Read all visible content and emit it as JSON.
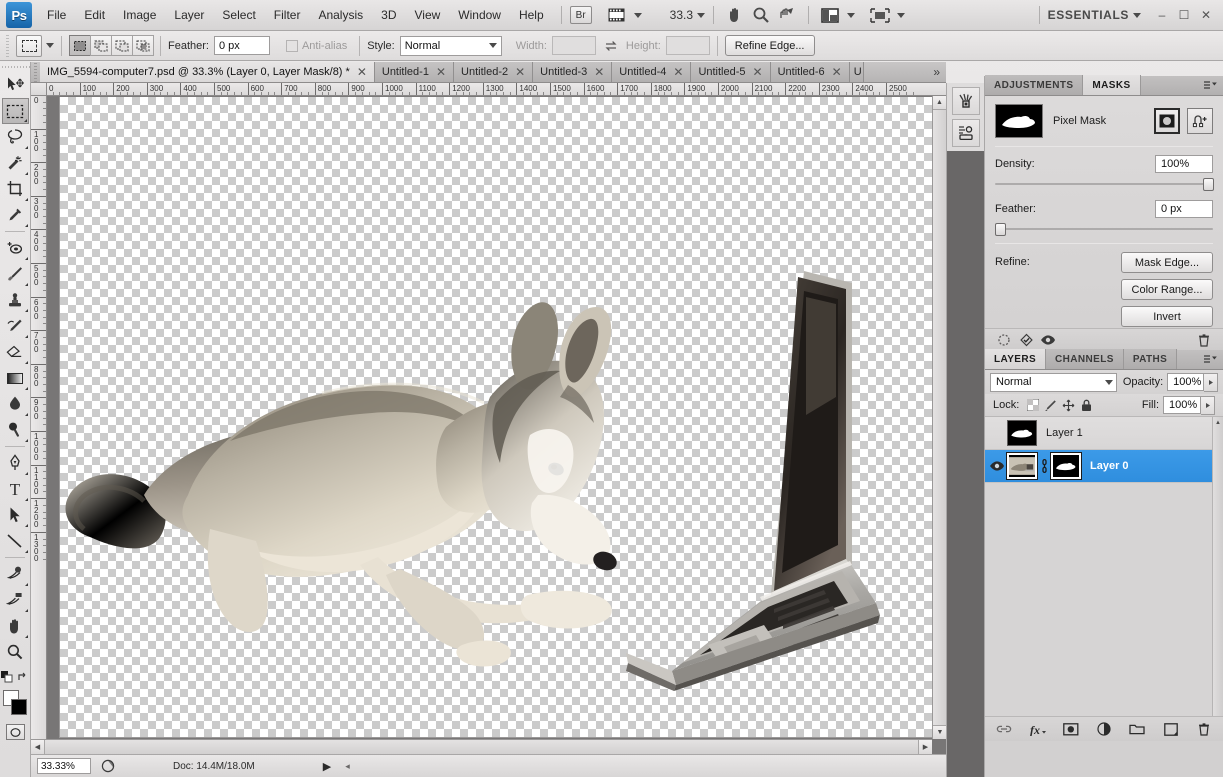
{
  "app": {
    "logo": "Ps",
    "menus": [
      "File",
      "Edit",
      "Image",
      "Layer",
      "Select",
      "Filter",
      "Analysis",
      "3D",
      "View",
      "Window",
      "Help"
    ],
    "bridge_label": "Br",
    "zoom_level": "33.3",
    "workspace": "ESSENTIALS",
    "window_buttons": {
      "minimize": "–",
      "maximize": "☐",
      "close": "✕"
    },
    "icons": {
      "view_extras": "view-extras-icon",
      "hand": "hand-tool-icon",
      "zoom": "zoom-tool-icon",
      "rotate_view": "rotate-view-tool-icon",
      "screen_mode": "screen-mode-icon",
      "arrange_docs": "arrange-documents-icon"
    }
  },
  "options_bar": {
    "tool": "rectangular-marquee",
    "bool_modes": [
      "new-selection",
      "add-to-selection",
      "subtract-from-selection",
      "intersect-with-selection"
    ],
    "feather_label": "Feather:",
    "feather_value": "0 px",
    "antialias_label": "Anti-alias",
    "antialias_enabled": false,
    "style_label": "Style:",
    "style_value": "Normal",
    "width_label": "Width:",
    "width_value": "",
    "height_label": "Height:",
    "height_value": "",
    "swap_icon": "swap-dimensions-icon",
    "refine_edge_label": "Refine Edge..."
  },
  "document_tabs": {
    "active": "IMG_5594-computer7.psd @ 33.3% (Layer 0, Layer Mask/8) *",
    "others": [
      "Untitled-1",
      "Untitled-2",
      "Untitled-3",
      "Untitled-4",
      "Untitled-5",
      "Untitled-6",
      "U"
    ],
    "overflow_label": "»",
    "close_glyph": "✕"
  },
  "toolbox": {
    "tools": [
      {
        "name": "move-tool",
        "selected": false,
        "has_flyout": false
      },
      {
        "name": "rectangular-marquee-tool",
        "selected": true,
        "has_flyout": true
      },
      {
        "name": "lasso-tool",
        "selected": false,
        "has_flyout": true
      },
      {
        "name": "magic-wand-tool",
        "selected": false,
        "has_flyout": true
      },
      {
        "name": "crop-tool",
        "selected": false,
        "has_flyout": true
      },
      {
        "name": "eyedropper-tool",
        "selected": false,
        "has_flyout": true
      },
      {
        "name": "spot-healing-brush-tool",
        "selected": false,
        "has_flyout": true
      },
      {
        "name": "brush-tool",
        "selected": false,
        "has_flyout": true
      },
      {
        "name": "clone-stamp-tool",
        "selected": false,
        "has_flyout": true
      },
      {
        "name": "history-brush-tool",
        "selected": false,
        "has_flyout": true
      },
      {
        "name": "eraser-tool",
        "selected": false,
        "has_flyout": true
      },
      {
        "name": "gradient-tool",
        "selected": false,
        "has_flyout": true
      },
      {
        "name": "blur-tool",
        "selected": false,
        "has_flyout": true
      },
      {
        "name": "dodge-tool",
        "selected": false,
        "has_flyout": true
      },
      {
        "name": "pen-tool",
        "selected": false,
        "has_flyout": true
      },
      {
        "name": "type-tool",
        "selected": false,
        "has_flyout": true
      },
      {
        "name": "path-selection-tool",
        "selected": false,
        "has_flyout": true
      },
      {
        "name": "line-tool",
        "selected": false,
        "has_flyout": true
      },
      {
        "name": "3d-rotate-tool",
        "selected": false,
        "has_flyout": true
      },
      {
        "name": "3d-orbit-camera-tool",
        "selected": false,
        "has_flyout": true
      },
      {
        "name": "hand-tool",
        "selected": false,
        "has_flyout": true
      },
      {
        "name": "zoom-tool",
        "selected": false,
        "has_flyout": false
      }
    ],
    "foreground_color": "#ffffff",
    "background_color": "#000000",
    "quick_mask_icon": "quick-mask-icon"
  },
  "rulers": {
    "unit_step": 100,
    "h_ticks": [
      "0",
      "100",
      "200",
      "300",
      "400",
      "500",
      "600",
      "700",
      "800",
      "900",
      "1000",
      "1100",
      "1200",
      "1300",
      "1400",
      "1500",
      "1600",
      "1700",
      "1800",
      "1900",
      "2000",
      "2100",
      "2200",
      "2300",
      "2400",
      "2500"
    ],
    "v_ticks": [
      "0",
      "100",
      "200",
      "300",
      "400",
      "500",
      "600",
      "700",
      "800",
      "900",
      "1000",
      "1100",
      "1200",
      "1300"
    ]
  },
  "canvas": {
    "transparency_grid": true,
    "artwork_description": "husky-dog-and-laptop"
  },
  "status_bar": {
    "zoom": "33.33%",
    "doc_info": "Doc: 14.4M/18.0M",
    "preview_icon": "preview-thumbnail-icon",
    "play_glyph": "▶",
    "left_glyph": "◂"
  },
  "icon_dock": {
    "buttons": [
      "history-panel-icon",
      "actions-panel-icon"
    ]
  },
  "masks_panel": {
    "tabs": [
      {
        "label": "ADJUSTMENTS",
        "active": false
      },
      {
        "label": "MASKS",
        "active": true
      }
    ],
    "mask_type": "Pixel Mask",
    "pixel_mask_button": "pixel-mask-icon",
    "vector_mask_button": "vector-mask-icon",
    "density_label": "Density:",
    "density_value": "100%",
    "density_percent": 100,
    "feather_label": "Feather:",
    "feather_value": "0 px",
    "feather_percent": 0,
    "refine_label": "Refine:",
    "mask_edge_label": "Mask Edge...",
    "color_range_label": "Color Range...",
    "invert_label": "Invert",
    "footer_icons": [
      "load-selection-from-mask-icon",
      "apply-mask-icon",
      "toggle-mask-icon",
      "delete-mask-icon"
    ]
  },
  "layers_panel": {
    "tabs": [
      {
        "label": "LAYERS",
        "active": true
      },
      {
        "label": "CHANNELS",
        "active": false
      },
      {
        "label": "PATHS",
        "active": false
      }
    ],
    "blend_mode": "Normal",
    "opacity_label": "Opacity:",
    "opacity_value": "100%",
    "lock_label": "Lock:",
    "lock_icons": [
      "lock-transparent-pixels-icon",
      "lock-image-pixels-icon",
      "lock-position-icon",
      "lock-all-icon"
    ],
    "fill_label": "Fill:",
    "fill_value": "100%",
    "layers": [
      {
        "name": "Layer 1",
        "visible": false,
        "selected": false,
        "has_mask": true,
        "has_thumb": false,
        "linked": false
      },
      {
        "name": "Layer 0",
        "visible": true,
        "selected": true,
        "has_mask": true,
        "has_thumb": true,
        "linked": true
      }
    ],
    "footer_icons": [
      "link-layers-icon",
      "layer-style-fx-icon",
      "add-layer-mask-icon",
      "new-adjustment-layer-icon",
      "new-group-icon",
      "new-layer-icon",
      "delete-layer-icon"
    ]
  },
  "colors": {
    "selection_blue": "#2f8ede",
    "panel_bg": "#d4d2d2",
    "canvas_surround": "#787676"
  }
}
